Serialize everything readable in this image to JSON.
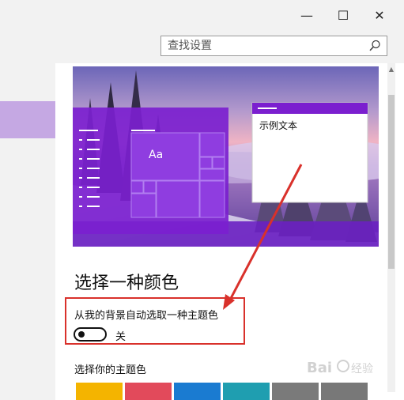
{
  "window": {
    "minimize_glyph": "—",
    "maximize_glyph": "☐",
    "close_glyph": "✕"
  },
  "search": {
    "placeholder": "查找设置"
  },
  "preview": {
    "tile_text": "Aa",
    "sample_window_text": "示例文本"
  },
  "main": {
    "section_title": "选择一种颜色",
    "auto_pick_label": "从我的背景自动选取一种主题色",
    "toggle": {
      "state": "off",
      "label": "关"
    },
    "pick_theme_label": "选择你的主题色",
    "swatches": [
      "#f4b400",
      "#e24a5b",
      "#1a7bd1",
      "#1f9eb0",
      "#7a7a7a",
      "#787878"
    ]
  },
  "colors": {
    "accent": "#7b1fcf",
    "sidebar_selected": "#c5a8e3",
    "annotation_red": "#d9312b"
  }
}
